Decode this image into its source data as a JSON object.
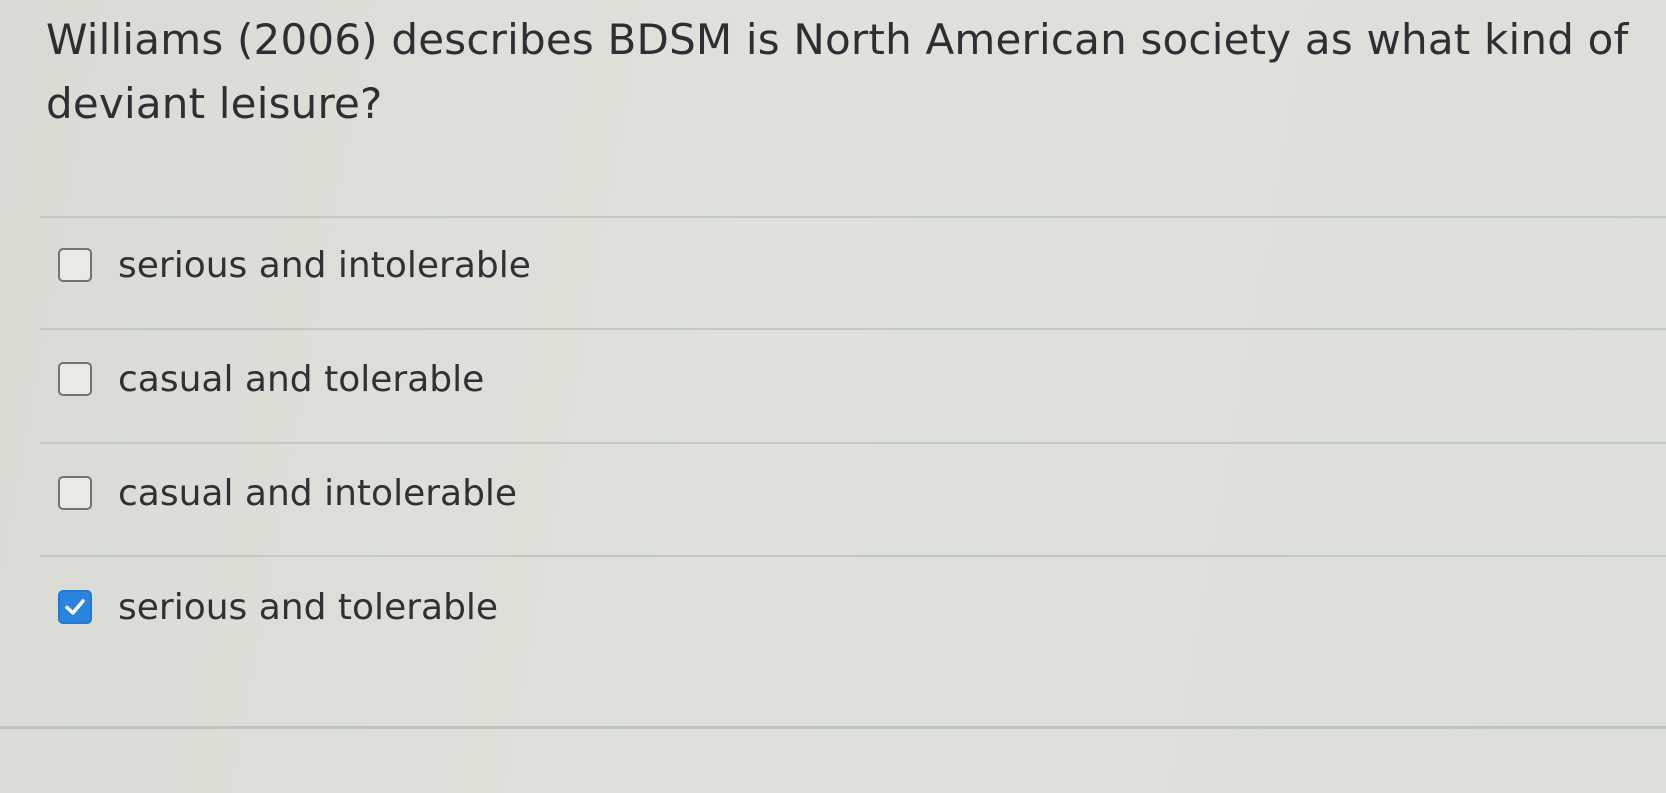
{
  "question": {
    "text": "Williams (2006) describes BDSM is North American society as what kind of deviant leisure?"
  },
  "options": [
    {
      "label": "serious and intolerable",
      "checked": false
    },
    {
      "label": "casual and tolerable",
      "checked": false
    },
    {
      "label": "casual and intolerable",
      "checked": false
    },
    {
      "label": "serious and tolerable",
      "checked": true
    }
  ],
  "colors": {
    "checked_accent": "#2a84dd",
    "background": "#dcdfd8",
    "text": "#2f3033"
  },
  "icons": {
    "checked": "checkmark-icon"
  }
}
